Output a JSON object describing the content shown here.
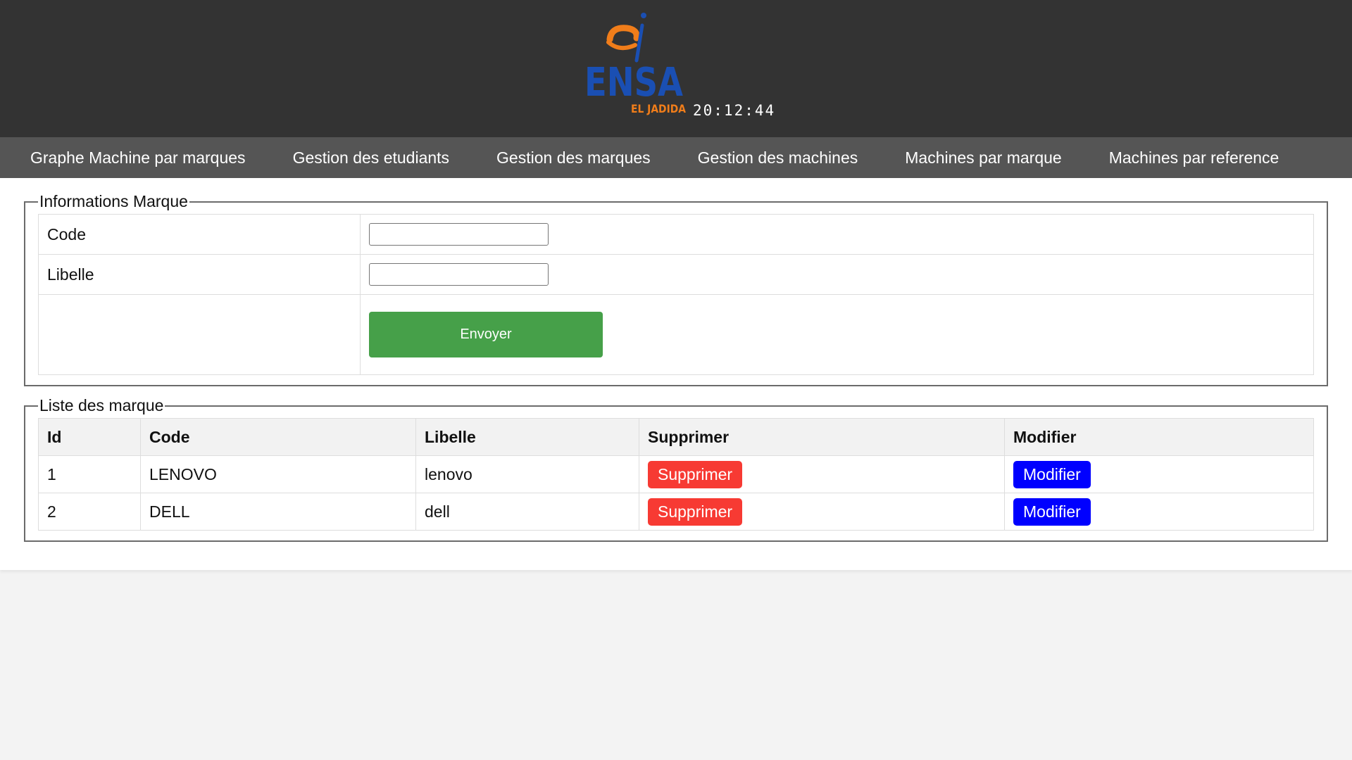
{
  "header": {
    "logo_text": "ENSA",
    "logo_subtext": "EL JADIDA",
    "clock": "20:12:44"
  },
  "nav": {
    "items": [
      {
        "label": "Graphe Machine par marques"
      },
      {
        "label": "Gestion des etudiants"
      },
      {
        "label": "Gestion des marques"
      },
      {
        "label": "Gestion des machines"
      },
      {
        "label": "Machines par marque"
      },
      {
        "label": "Machines par reference"
      }
    ]
  },
  "form": {
    "legend": "Informations Marque",
    "code_label": "Code",
    "code_value": "",
    "libelle_label": "Libelle",
    "libelle_value": "",
    "submit_label": "Envoyer"
  },
  "list": {
    "legend": "Liste des marque",
    "columns": [
      "Id",
      "Code",
      "Libelle",
      "Supprimer",
      "Modifier"
    ],
    "rows": [
      {
        "id": "1",
        "code": "LENOVO",
        "libelle": "lenovo",
        "delete_label": "Supprimer",
        "edit_label": "Modifier"
      },
      {
        "id": "2",
        "code": "DELL",
        "libelle": "dell",
        "delete_label": "Supprimer",
        "edit_label": "Modifier"
      }
    ]
  },
  "colors": {
    "header_bg": "#333333",
    "nav_bg": "#555555",
    "submit_green": "#46a049",
    "delete_red": "#f73a33",
    "edit_blue": "#0000ff",
    "logo_blue": "#1a4fb3",
    "logo_orange": "#f07d1a"
  }
}
